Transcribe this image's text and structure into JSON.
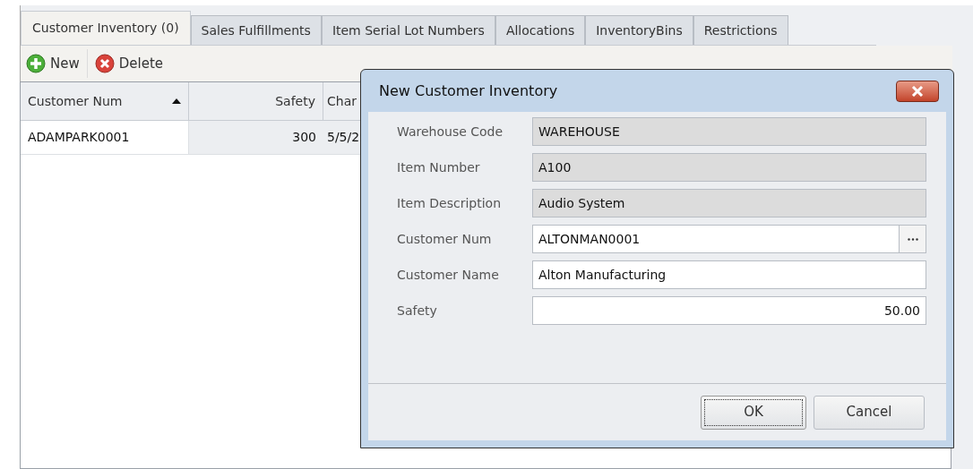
{
  "tabs": [
    {
      "label": "Customer Inventory (0)",
      "selected": true
    },
    {
      "label": "Sales Fulfillments",
      "selected": false
    },
    {
      "label": "Item Serial Lot Numbers",
      "selected": false
    },
    {
      "label": "Allocations",
      "selected": false
    },
    {
      "label": "InventoryBins",
      "selected": false
    },
    {
      "label": "Restrictions",
      "selected": false
    }
  ],
  "toolbar": [
    {
      "label": "New",
      "kind": "add"
    },
    {
      "label": "Delete",
      "kind": "delete"
    }
  ],
  "grid": {
    "columns": [
      {
        "label": "Customer Num",
        "sorted": true
      },
      {
        "label": "Safety",
        "sorted": false
      },
      {
        "label": "Char",
        "sorted": false
      }
    ],
    "rows": [
      [
        "ADAMPARK0001",
        "300",
        "5/5/2"
      ]
    ]
  },
  "dialog": {
    "title": "New Customer Inventory",
    "fields": [
      {
        "label": "Warehouse Code",
        "value": "WAREHOUSE",
        "kind": "readonly"
      },
      {
        "label": "Item Number",
        "value": "A100",
        "kind": "readonly"
      },
      {
        "label": "Item Description",
        "value": "Audio System",
        "kind": "readonly"
      },
      {
        "label": "Customer Num",
        "value": "ALTONMAN0001",
        "kind": "lookup"
      },
      {
        "label": "Customer Name",
        "value": "Alton Manufacturing",
        "kind": "text"
      },
      {
        "label": "Safety",
        "value": "50.00",
        "kind": "number"
      }
    ],
    "buttons": [
      {
        "label": "OK",
        "default": true
      },
      {
        "label": "Cancel",
        "default": false
      }
    ]
  }
}
